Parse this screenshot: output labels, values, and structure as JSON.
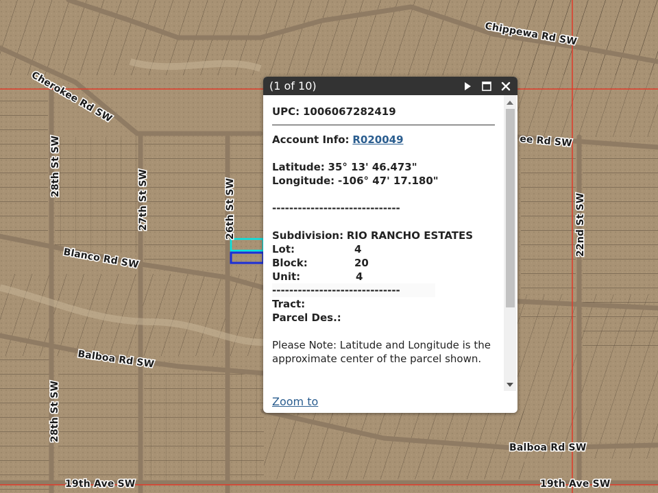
{
  "map": {
    "roads": {
      "chippewa": "Chippewa Rd SW",
      "cherokee": "Cherokee Rd SW",
      "cherokee_right": "ee Rd SW",
      "st28_top": "28th St SW",
      "st27": "27th St SW",
      "st26": "26th St SW",
      "st22": "22nd St SW",
      "blanco": "Blanco Rd SW",
      "balboa_left": "Balboa Rd SW",
      "balboa_right": "Balboa Rd SW",
      "st28_bottom": "28th St SW",
      "ave19_left": "19th Ave SW",
      "ave19_right": "19th Ave SW"
    },
    "colors": {
      "terrain": "#a89274",
      "road": "#8a7660",
      "lot_line": "#3e3226",
      "boundary": "#e23a2a",
      "selected_outline": "#00e5e5",
      "selected_fill": "#1b2fd8"
    }
  },
  "popup": {
    "title": "(1 of 10)",
    "upc_label": "UPC:",
    "upc_value": "1006067282419",
    "account_label": "Account Info:",
    "account_value": "R020049",
    "latitude_label": "Latitude:",
    "latitude_value": "35° 13' 46.473\"",
    "longitude_label": "Longitude:",
    "longitude_value": "-106° 47' 17.180\"",
    "dashes": "------------------------------",
    "subdivision_label": "Subdivision:",
    "subdivision_value": "RIO RANCHO ESTATES",
    "lot_label": "Lot:",
    "lot_value": "4",
    "block_label": "Block:",
    "block_value": "20",
    "unit_label": "Unit:",
    "unit_value": "4",
    "tract_label": "Tract:",
    "parcel_label": "Parcel Des.:",
    "note": "Please Note: Latitude and Longitude is the approximate center of the parcel shown.",
    "zoom_label": "Zoom to",
    "icons": {
      "next": "play-icon",
      "maximize": "maximize-icon",
      "close": "close-icon"
    }
  }
}
